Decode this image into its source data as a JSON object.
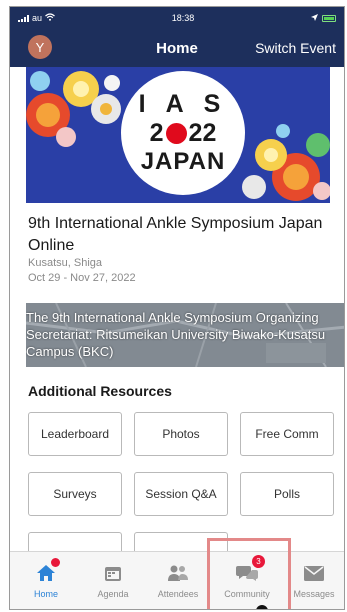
{
  "status_bar": {
    "carrier": "au",
    "time": "18:38"
  },
  "header": {
    "avatar_letter": "Y",
    "title": "Home",
    "switch_event_label": "Switch Event"
  },
  "banner": {
    "logo_line1": "I A S",
    "logo_line2a": "2",
    "logo_line2b": "22",
    "logo_line3": "JAPAN",
    "accent": "#e00a1c"
  },
  "event": {
    "title": "9th International Ankle Symposium Japan Online",
    "location": "Kusatsu, Shiga",
    "dates": "Oct 29 - Nov 27, 2022",
    "organizer": "The 9th International Ankle Symposium Organizing Secretariat: Ritsumeikan University Biwako-Kusatsu Campus (BKC)"
  },
  "resources": {
    "heading": "Additional Resources",
    "items": [
      "Leaderboard",
      "Photos",
      "Free Comm",
      "Surveys",
      "Session Q&A",
      "Polls"
    ]
  },
  "tabs": [
    {
      "label": "Home",
      "icon": "house-icon",
      "active": true
    },
    {
      "label": "Agenda",
      "icon": "calendar-icon",
      "active": false
    },
    {
      "label": "Attendees",
      "icon": "people-icon",
      "active": false
    },
    {
      "label": "Community",
      "icon": "chat-bubbles-icon",
      "active": false,
      "badge": "3"
    },
    {
      "label": "Messages",
      "icon": "envelope-icon",
      "active": false
    }
  ],
  "colors": {
    "nav_bg": "#1d2f5c",
    "active_tab": "#2c83d6",
    "badge": "#e8183a",
    "highlight": "#e38989"
  }
}
